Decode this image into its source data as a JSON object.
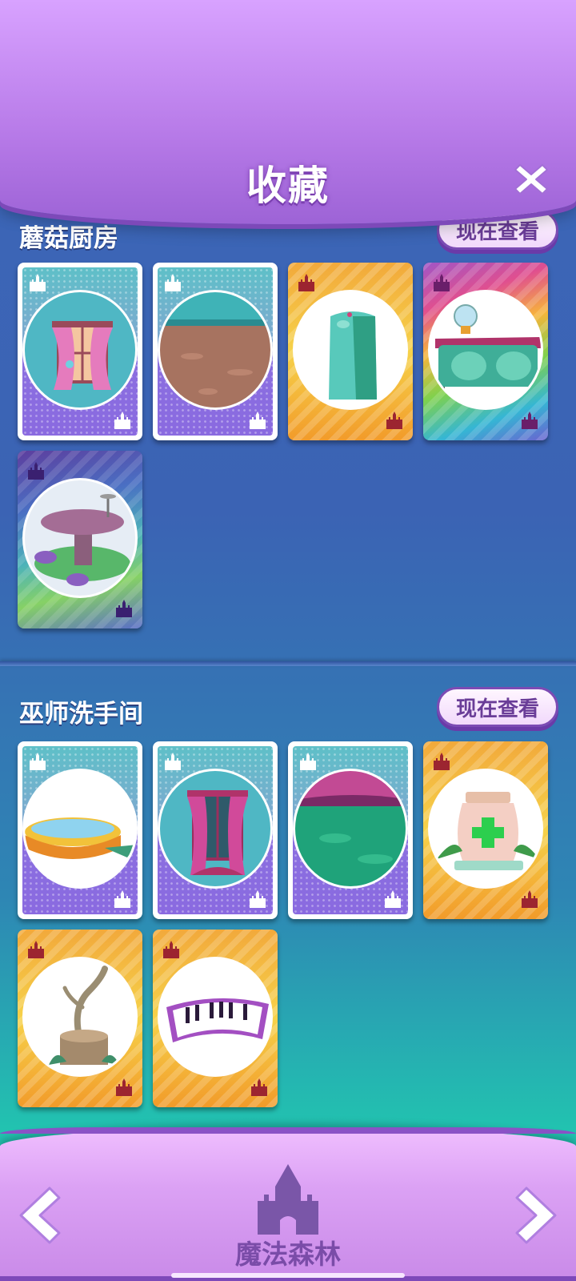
{
  "header": {
    "title": "收藏"
  },
  "sections": [
    {
      "title": "蘑菇厨房",
      "view_label": "现在查看",
      "cards": [
        {
          "style": "purple",
          "item": "pink-curtain-window"
        },
        {
          "style": "purple",
          "item": "brown-floor"
        },
        {
          "style": "gold",
          "item": "green-cabinet"
        },
        {
          "style": "rainbow",
          "item": "kitchen-counter"
        },
        {
          "style": "rainbow-dark",
          "item": "mushroom-table"
        }
      ]
    },
    {
      "title": "巫师洗手间",
      "view_label": "现在查看",
      "cards": [
        {
          "style": "purple",
          "item": "bathtub"
        },
        {
          "style": "purple",
          "item": "night-window"
        },
        {
          "style": "purple",
          "item": "green-floor"
        },
        {
          "style": "gold",
          "item": "medicine-jar"
        },
        {
          "style": "gold",
          "item": "tree-stump"
        },
        {
          "style": "gold",
          "item": "piano-mat"
        }
      ]
    }
  ],
  "footer": {
    "world_name": "魔法森林"
  }
}
